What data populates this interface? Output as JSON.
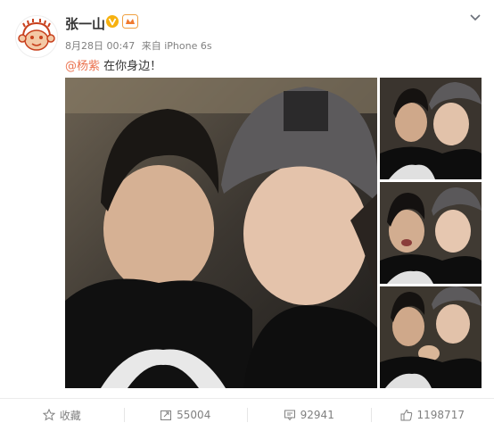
{
  "post": {
    "username": "张一山",
    "date": "8月28日 00:47",
    "source_prefix": "来自",
    "source": "iPhone 6s",
    "mention": "@杨紫",
    "caption_text": " 在你身边！"
  },
  "actions": {
    "favorite_label": "收藏",
    "repost_count": "55004",
    "comment_count": "92941",
    "like_count": "1198717"
  },
  "colors": {
    "mention": "#eb7350",
    "vip_badge": "#f6b10f",
    "text_secondary": "#808080"
  },
  "icons": {
    "avatar": "monkey-avatar-icon",
    "verified": "v-badge-icon",
    "level": "level-badge-icon",
    "menu": "chevron-down-icon",
    "favorite": "star-icon",
    "repost": "repost-icon",
    "comment": "comment-icon",
    "like": "thumbs-up-icon"
  }
}
